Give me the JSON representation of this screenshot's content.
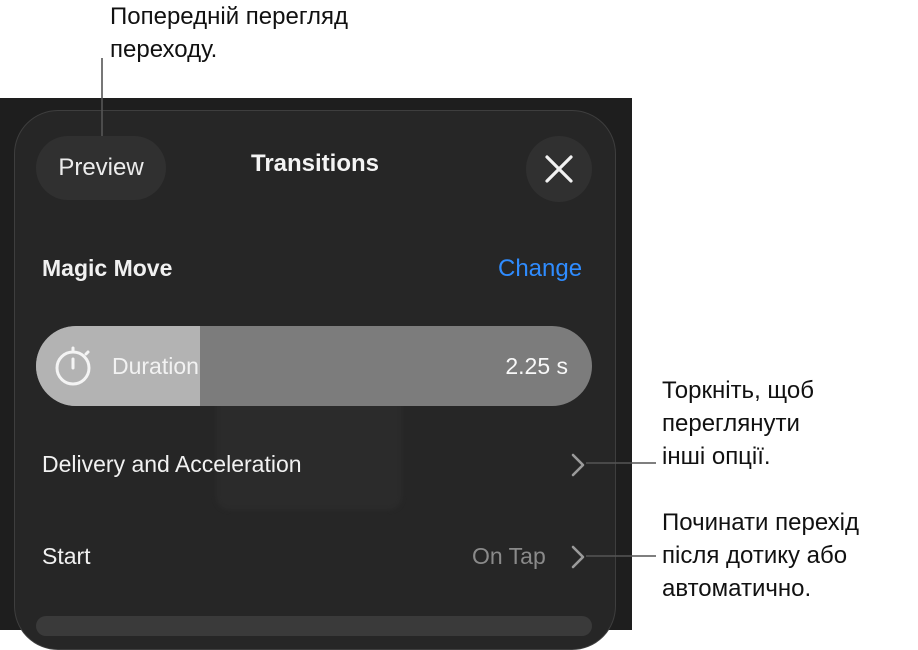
{
  "callouts": {
    "preview": [
      "Попередній перегляд",
      "переходу."
    ],
    "options": [
      "Торкніть, щоб",
      "переглянути",
      "інші опції."
    ],
    "start": [
      "Починати перехід",
      "після дотику або",
      "автоматично."
    ]
  },
  "header": {
    "preview_label": "Preview",
    "title": "Transitions",
    "close_icon": "close-icon"
  },
  "effect": {
    "name": "Magic Move",
    "change_label": "Change"
  },
  "duration": {
    "label": "Duration",
    "value": "2.25 s",
    "fill_fraction": 0.295,
    "icon": "stopwatch-icon"
  },
  "rows": {
    "delivery_label": "Delivery and Acceleration",
    "start_label": "Start",
    "start_value": "On Tap",
    "chevron_icon": "chevron-right-icon"
  },
  "colors": {
    "accent": "#2f8cff",
    "panel": "#262626",
    "slider_track": "#7c7c7c",
    "slider_fill": "#b3b3b3"
  }
}
